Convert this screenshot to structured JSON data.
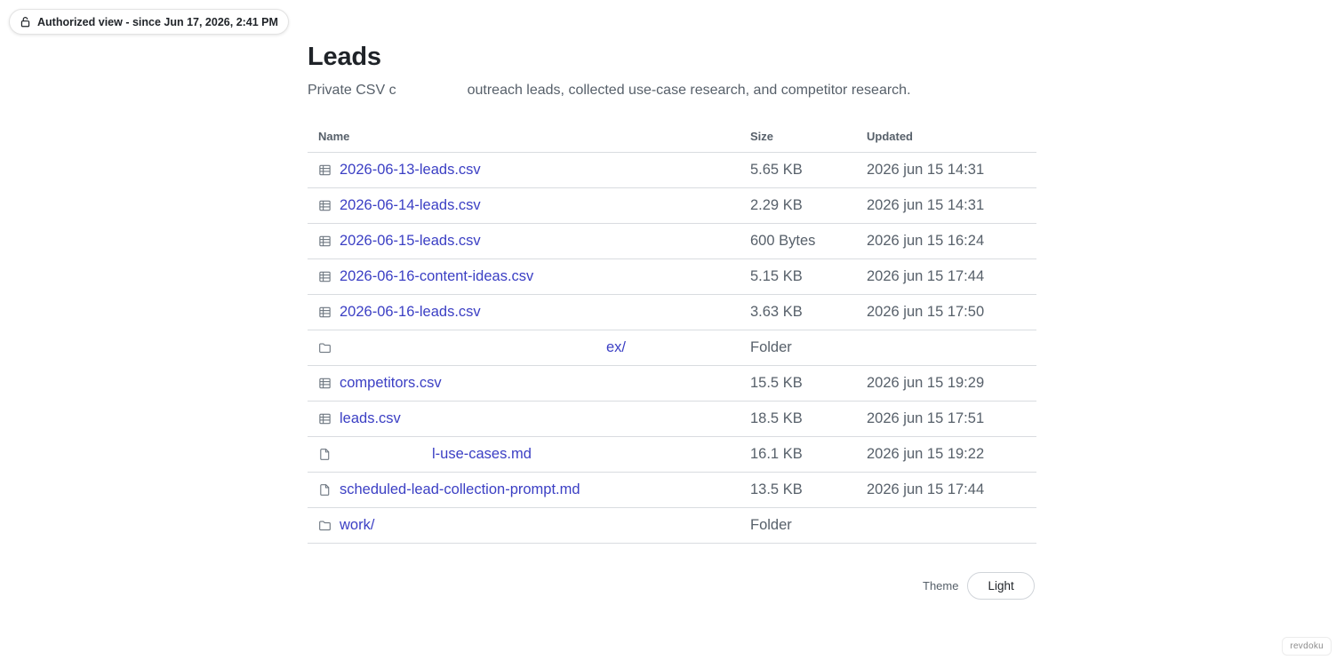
{
  "auth": {
    "icon": "lock-icon",
    "label": "Authorized view - since Jun 17, 2026, 2:41 PM"
  },
  "page": {
    "title": "Leads",
    "subtitle_start": "Private CSV c",
    "subtitle_end": "outreach leads, collected use-case research, and competitor research."
  },
  "table": {
    "headers": {
      "name": "Name",
      "size": "Size",
      "updated": "Updated"
    },
    "rows": [
      {
        "icon": "spreadsheet-icon",
        "name": "2026-06-13-leads.csv",
        "size": "5.65 KB",
        "updated": "2026 jun 15 14:31"
      },
      {
        "icon": "spreadsheet-icon",
        "name": "2026-06-14-leads.csv",
        "size": "2.29 KB",
        "updated": "2026 jun 15 14:31"
      },
      {
        "icon": "spreadsheet-icon",
        "name": "2026-06-15-leads.csv",
        "size": "600 Bytes",
        "updated": "2026 jun 15 16:24"
      },
      {
        "icon": "spreadsheet-icon",
        "name": "2026-06-16-content-ideas.csv",
        "size": "5.15 KB",
        "updated": "2026 jun 15 17:44"
      },
      {
        "icon": "spreadsheet-icon",
        "name": "2026-06-16-leads.csv",
        "size": "3.63 KB",
        "updated": "2026 jun 15 17:50"
      },
      {
        "icon": "folder-icon",
        "name": "ex/",
        "size": "Folder",
        "updated": ""
      },
      {
        "icon": "spreadsheet-icon",
        "name": "competitors.csv",
        "size": "15.5 KB",
        "updated": "2026 jun 15 19:29"
      },
      {
        "icon": "spreadsheet-icon",
        "name": "leads.csv",
        "size": "18.5 KB",
        "updated": "2026 jun 15 17:51"
      },
      {
        "icon": "document-icon",
        "name": "l-use-cases.md",
        "size": "16.1 KB",
        "updated": "2026 jun 15 19:22"
      },
      {
        "icon": "document-icon",
        "name": "scheduled-lead-collection-prompt.md",
        "size": "13.5 KB",
        "updated": "2026 jun 15 17:44"
      },
      {
        "icon": "folder-icon",
        "name": "work/",
        "size": "Folder",
        "updated": ""
      }
    ]
  },
  "theme": {
    "label": "Theme",
    "value": "Light"
  },
  "brand": "revdoku",
  "colors": {
    "link": "#3b3fc4",
    "muted": "#57606a",
    "text": "#1f2328",
    "border": "#d9dce0"
  }
}
